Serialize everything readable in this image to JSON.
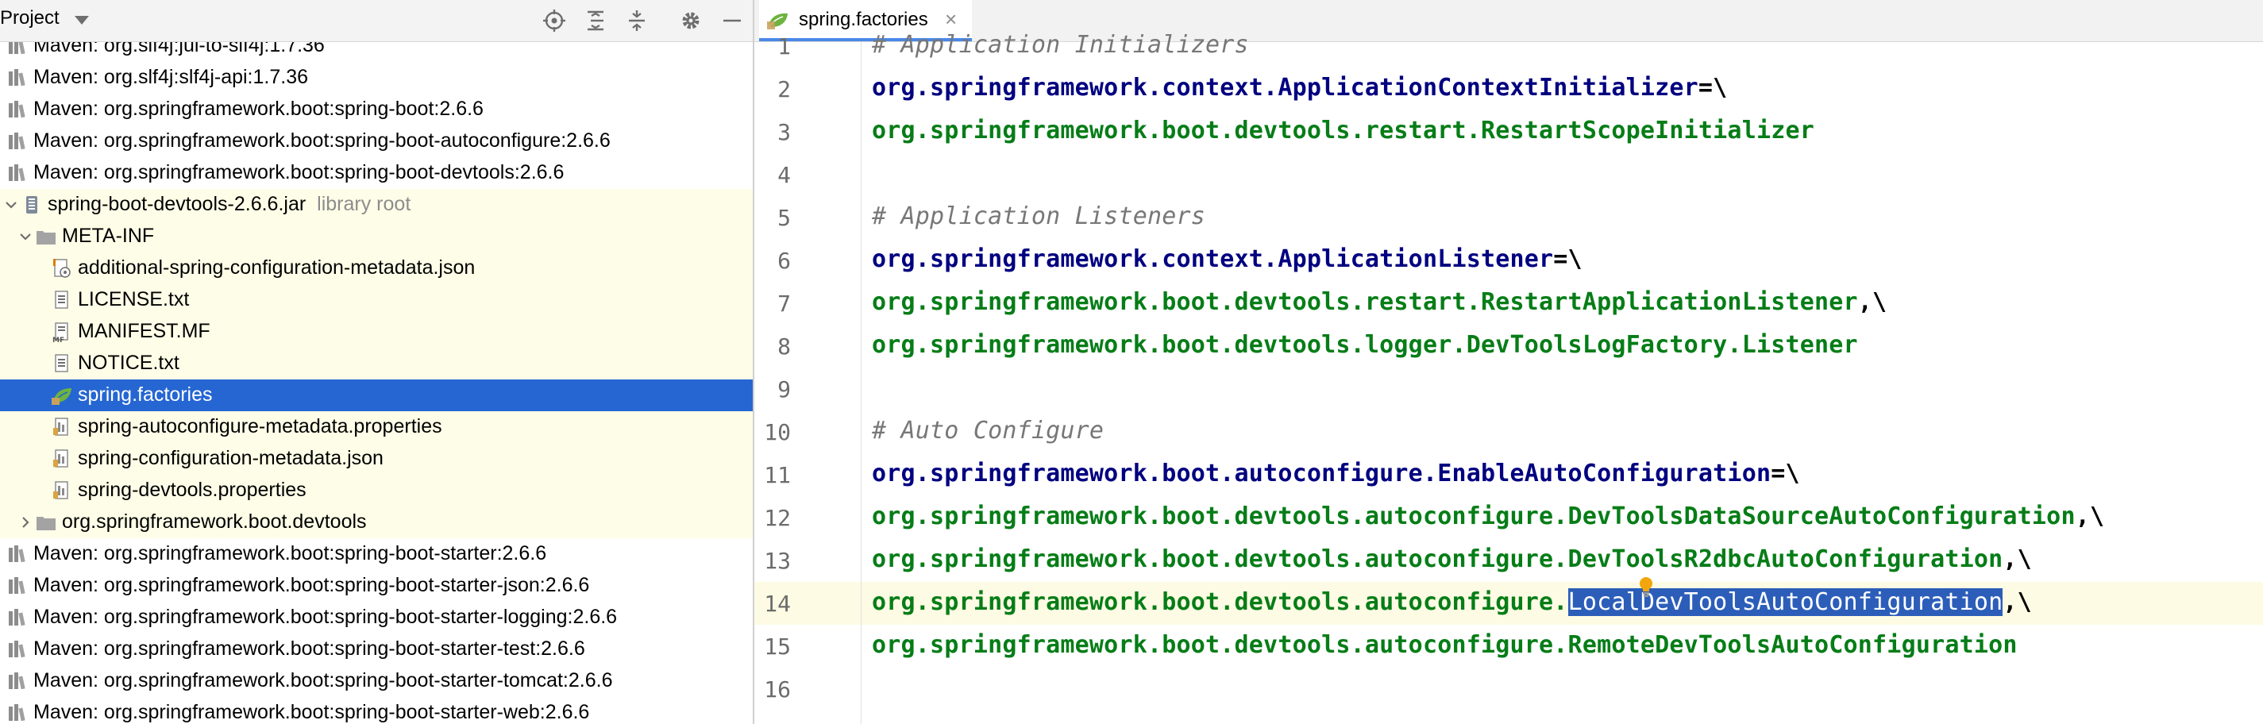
{
  "project_panel": {
    "title": "Project",
    "toolbar_icons": [
      "locate-icon",
      "expand-all-icon",
      "collapse-all-icon",
      "gear-icon",
      "minimize-icon"
    ],
    "tree": [
      {
        "label": "Maven: org.slf4j:jul-to-slf4j:1.7.36",
        "icon": "library-icon",
        "level": 0
      },
      {
        "label": "Maven: org.slf4j:slf4j-api:1.7.36",
        "icon": "library-icon",
        "level": 0
      },
      {
        "label": "Maven: org.springframework.boot:spring-boot:2.6.6",
        "icon": "library-icon",
        "level": 0
      },
      {
        "label": "Maven: org.springframework.boot:spring-boot-autoconfigure:2.6.6",
        "icon": "library-icon",
        "level": 0
      },
      {
        "label": "Maven: org.springframework.boot:spring-boot-devtools:2.6.6",
        "icon": "library-icon",
        "level": 0
      },
      {
        "label": "spring-boot-devtools-2.6.6.jar",
        "suffix": "library root",
        "icon": "jar-icon",
        "level": 1,
        "expanded": true
      },
      {
        "label": "META-INF",
        "icon": "folder-icon",
        "level": 2,
        "expanded": true
      },
      {
        "label": "additional-spring-configuration-metadata.json",
        "icon": "json-icon",
        "level": 3
      },
      {
        "label": "LICENSE.txt",
        "icon": "text-file-icon",
        "level": 3
      },
      {
        "label": "MANIFEST.MF",
        "icon": "manifest-icon",
        "level": 3
      },
      {
        "label": "NOTICE.txt",
        "icon": "text-file-icon",
        "level": 3
      },
      {
        "label": "spring.factories",
        "icon": "spring-icon",
        "level": 3,
        "selected": true
      },
      {
        "label": "spring-autoconfigure-metadata.properties",
        "icon": "properties-icon",
        "level": 3
      },
      {
        "label": "spring-configuration-metadata.json",
        "icon": "properties-icon",
        "level": 3
      },
      {
        "label": "spring-devtools.properties",
        "icon": "properties-icon",
        "level": 3
      },
      {
        "label": "org.springframework.boot.devtools",
        "icon": "folder-icon",
        "level": 2,
        "expanded": false
      },
      {
        "label": "Maven: org.springframework.boot:spring-boot-starter:2.6.6",
        "icon": "library-icon",
        "level": 0
      },
      {
        "label": "Maven: org.springframework.boot:spring-boot-starter-json:2.6.6",
        "icon": "library-icon",
        "level": 0
      },
      {
        "label": "Maven: org.springframework.boot:spring-boot-starter-logging:2.6.6",
        "icon": "library-icon",
        "level": 0
      },
      {
        "label": "Maven: org.springframework.boot:spring-boot-starter-test:2.6.6",
        "icon": "library-icon",
        "level": 0
      },
      {
        "label": "Maven: org.springframework.boot:spring-boot-starter-tomcat:2.6.6",
        "icon": "library-icon",
        "level": 0
      },
      {
        "label": "Maven: org.springframework.boot:spring-boot-starter-web:2.6.6",
        "icon": "library-icon",
        "level": 0
      }
    ]
  },
  "editor": {
    "tab": {
      "label": "spring.factories",
      "close": "×",
      "icon": "spring-icon"
    },
    "current_line": 14,
    "lines": [
      {
        "n": "1",
        "parts": [
          {
            "t": "# Application Initializers",
            "c": "comment"
          }
        ]
      },
      {
        "n": "2",
        "parts": [
          {
            "t": "org.springframework.context.ApplicationContextInitializer",
            "c": "key"
          },
          {
            "t": "=\\",
            "c": "op"
          }
        ]
      },
      {
        "n": "3",
        "parts": [
          {
            "t": "org.springframework.boot.devtools.restart.RestartScopeInitializer",
            "c": "val"
          }
        ]
      },
      {
        "n": "4",
        "parts": []
      },
      {
        "n": "5",
        "parts": [
          {
            "t": "# Application Listeners",
            "c": "comment"
          }
        ]
      },
      {
        "n": "6",
        "parts": [
          {
            "t": "org.springframework.context.ApplicationListener",
            "c": "key"
          },
          {
            "t": "=\\",
            "c": "op"
          }
        ]
      },
      {
        "n": "7",
        "parts": [
          {
            "t": "org.springframework.boot.devtools.restart.RestartApplicationListener",
            "c": "val"
          },
          {
            "t": ",\\",
            "c": "op"
          }
        ]
      },
      {
        "n": "8",
        "parts": [
          {
            "t": "org.springframework.boot.devtools.logger.DevToolsLogFactory.Listener",
            "c": "val"
          }
        ]
      },
      {
        "n": "9",
        "parts": []
      },
      {
        "n": "10",
        "parts": [
          {
            "t": "# Auto Configure",
            "c": "comment"
          }
        ]
      },
      {
        "n": "11",
        "parts": [
          {
            "t": "org.springframework.boot.autoconfigure.EnableAutoConfiguration",
            "c": "key"
          },
          {
            "t": "=\\",
            "c": "op"
          }
        ]
      },
      {
        "n": "12",
        "parts": [
          {
            "t": "org.springframework.boot.devtools.autoconfigure.DevToolsDataSourceAutoConfiguration",
            "c": "val"
          },
          {
            "t": ",\\",
            "c": "op"
          }
        ]
      },
      {
        "n": "13",
        "parts": [
          {
            "t": "org.springframework.boot.devtools.autoconfigure.DevToolsR2dbcAutoConfiguration",
            "c": "val"
          },
          {
            "t": ",\\",
            "c": "op"
          }
        ]
      },
      {
        "n": "14",
        "parts": [
          {
            "t": "org.springframework.boot.devtools.autoconfigure.",
            "c": "val"
          },
          {
            "t": "LocalDevToolsAutoConfiguration",
            "c": "sel"
          },
          {
            "t": ",\\",
            "c": "op"
          }
        ]
      },
      {
        "n": "15",
        "parts": [
          {
            "t": "org.springframework.boot.devtools.autoconfigure.RemoteDevToolsAutoConfiguration",
            "c": "val"
          }
        ]
      },
      {
        "n": "16",
        "parts": []
      }
    ]
  },
  "colors": {
    "selection": "#2566d2",
    "library_root_bg": "#fefee8",
    "key": "#000080",
    "value": "#067d17",
    "comment": "#777777"
  }
}
